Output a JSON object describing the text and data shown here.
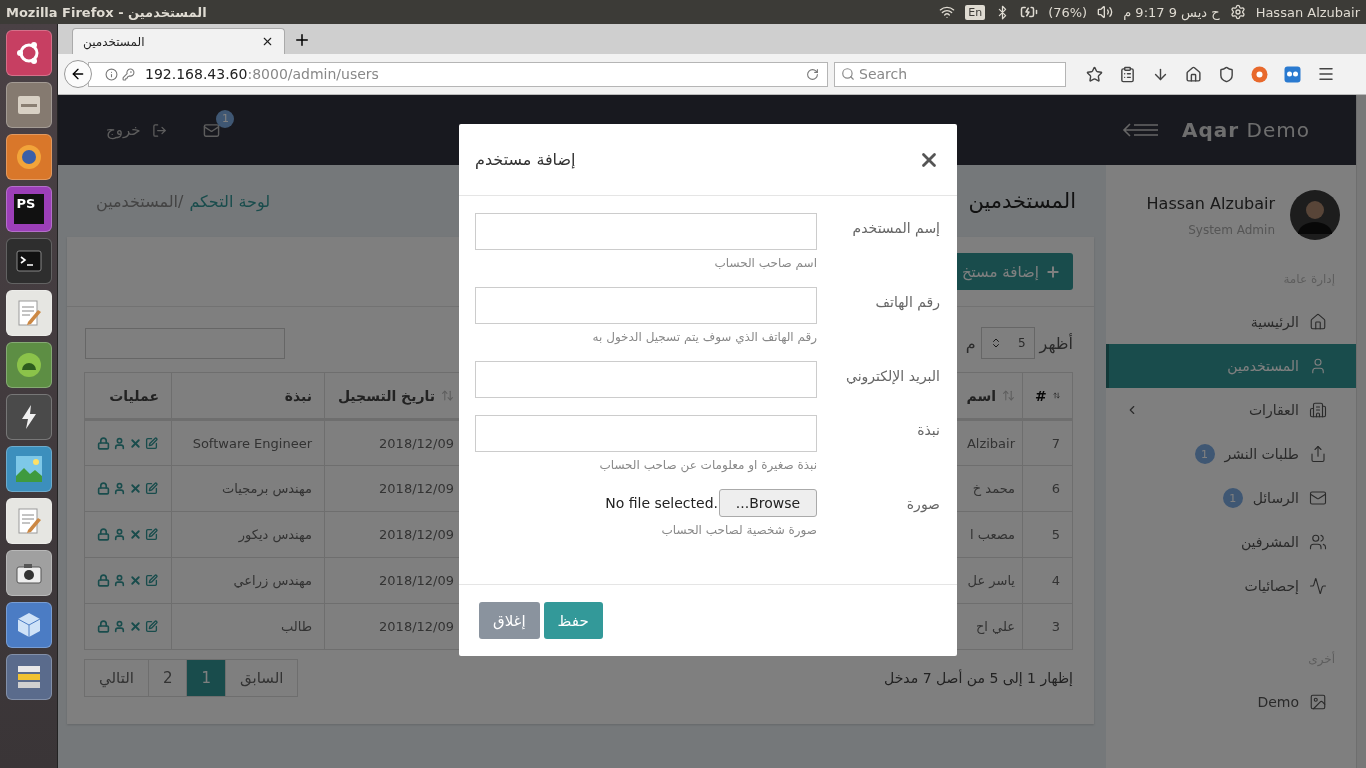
{
  "desktop_panel": {
    "window_title": "Mozilla Firefox - المستخدمين",
    "keyboard": "En",
    "battery": "(76%)",
    "clock": "ح ديس 9 9:17 م",
    "user": "Hassan Alzubair"
  },
  "launcher": [
    {
      "kind": "ubuntu"
    },
    {
      "kind": "files"
    },
    {
      "kind": "firefox"
    },
    {
      "kind": "phpstorm",
      "label": "PS"
    },
    {
      "kind": "terminal"
    },
    {
      "kind": "editor"
    },
    {
      "kind": "android"
    },
    {
      "kind": "bolt"
    },
    {
      "kind": "game"
    },
    {
      "kind": "editor"
    },
    {
      "kind": "camera"
    },
    {
      "kind": "cube"
    },
    {
      "kind": "stack"
    }
  ],
  "browser": {
    "tab": {
      "title": "المستخدمين",
      "selected": true
    },
    "url": {
      "host": "192.168.43.60",
      "path": ":8000/admin/users"
    },
    "search_placeholder": "Search"
  },
  "header": {
    "brand_bold": "Aqar",
    "brand_rest": "Demo",
    "logout": "خروج",
    "messages_badge": "1"
  },
  "sidebar": {
    "user_name": "Hassan Alzubair",
    "user_role": "System Admin",
    "sections": [
      {
        "title": "إدارة عامة",
        "items": [
          {
            "label": "الرئيسية",
            "kind": "home",
            "selected": false,
            "has_submenu": false
          },
          {
            "label": "المستخدمين",
            "kind": "user",
            "selected": true,
            "has_submenu": false
          },
          {
            "label": "العقارات",
            "kind": "building",
            "selected": false,
            "has_submenu": true
          },
          {
            "label": "طلبات النشر",
            "kind": "share",
            "selected": false,
            "has_submenu": false,
            "badge": "1"
          },
          {
            "label": "الرسائل",
            "kind": "mail",
            "selected": false,
            "has_submenu": false,
            "badge": "1"
          },
          {
            "label": "المشرفين",
            "kind": "team",
            "selected": false,
            "has_submenu": false
          },
          {
            "label": "إحصائيات",
            "kind": "stats",
            "selected": false,
            "has_submenu": false
          }
        ]
      },
      {
        "title": "أخرى",
        "items": [
          {
            "label": "Demo",
            "kind": "image",
            "selected": false,
            "has_submenu": false
          }
        ]
      }
    ]
  },
  "page": {
    "title": "المستخدمين",
    "breadcrumbs": [
      {
        "label": "لوحة التحكم",
        "kind": "link"
      },
      {
        "label": "/المستخدمين",
        "kind": "current"
      }
    ],
    "add_button": "إضافة مستخ",
    "length_label": "أظهر",
    "length_value": "5",
    "length_suffix": "م"
  },
  "table": {
    "columns": [
      {
        "label": "#",
        "sortable": true,
        "sorted": true
      },
      {
        "label": "اسم",
        "sortable": true,
        "sorted": false
      },
      {
        "label": "تاريخ التسجيل",
        "sortable": true,
        "sorted": false
      },
      {
        "label": "نبذة",
        "sortable": false,
        "sorted": false
      },
      {
        "label": "عمليات",
        "sortable": false,
        "sorted": false
      }
    ],
    "rows": [
      [
        "7",
        "Alzibair",
        "2018/12/09",
        "Software Engineer"
      ],
      [
        "6",
        "محمد خ",
        "2018/12/09",
        "مهندس برمجيات"
      ],
      [
        "5",
        "مصعب ا",
        "2018/12/09",
        "مهندس ديكور"
      ],
      [
        "4",
        "ياسر عل",
        "2018/12/09",
        "مهندس زراعي"
      ],
      [
        "3",
        "علي اح",
        "2018/12/09",
        "طالب"
      ]
    ]
  },
  "pagination": {
    "info": "إظهار 1 إلى 5 من أصل 7 مدخل",
    "pages": [
      {
        "label": "السابق",
        "selected": false
      },
      {
        "label": "1",
        "selected": true
      },
      {
        "label": "2",
        "selected": false
      },
      {
        "label": "التالي",
        "selected": false
      }
    ]
  },
  "modal": {
    "title": "إضافة مستخدم",
    "fields": [
      {
        "kind": "text",
        "label": "إسم المستخدم",
        "help": "اسم صاحب الحساب"
      },
      {
        "kind": "text",
        "label": "رقم الهاتف",
        "help": "رقم الهاتف الذي سوف يتم تسجيل الدخول به"
      },
      {
        "kind": "text",
        "label": "البريد الإلكتروني"
      },
      {
        "kind": "text",
        "label": "نبذة",
        "help": "نبذة صغيرة او معلومات عن صاحب الحساب"
      },
      {
        "kind": "file",
        "label": "صورة",
        "file_status": "No file selected.",
        "browse": "Browse...",
        "help": "صورة شخصية لصاحب الحساب"
      }
    ],
    "buttons": [
      {
        "label": "حفظ",
        "kind": "primary"
      },
      {
        "label": "إغلاق",
        "kind": "secondary"
      }
    ]
  }
}
